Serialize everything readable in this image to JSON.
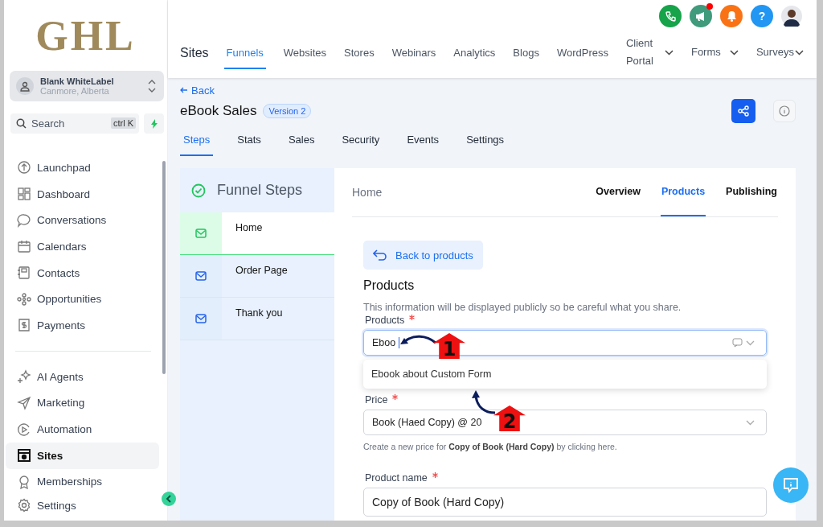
{
  "logo": "GHL",
  "account": {
    "name": "Blank WhiteLabel",
    "location": "Canmore, Alberta"
  },
  "search": {
    "placeholder": "Search",
    "shortcut": "ctrl K"
  },
  "nav_groups": [
    [
      {
        "label": "Launchpad",
        "selected": false
      },
      {
        "label": "Dashboard",
        "selected": false
      },
      {
        "label": "Conversations",
        "selected": false
      },
      {
        "label": "Calendars",
        "selected": false
      },
      {
        "label": "Contacts",
        "selected": false
      },
      {
        "label": "Opportunities",
        "selected": false
      },
      {
        "label": "Payments",
        "selected": false
      }
    ],
    [
      {
        "label": "AI Agents",
        "selected": false
      },
      {
        "label": "Marketing",
        "selected": false
      },
      {
        "label": "Automation",
        "selected": false
      },
      {
        "label": "Sites",
        "selected": true
      },
      {
        "label": "Memberships",
        "selected": false
      },
      {
        "label": "Settings",
        "selected": false
      }
    ]
  ],
  "header": {
    "title": "Sites",
    "tabs": [
      {
        "label": "Funnels",
        "selected": true,
        "dropdown": false
      },
      {
        "label": "Websites",
        "selected": false,
        "dropdown": false
      },
      {
        "label": "Stores",
        "selected": false,
        "dropdown": false
      },
      {
        "label": "Webinars",
        "selected": false,
        "dropdown": false
      },
      {
        "label": "Analytics",
        "selected": false,
        "dropdown": false
      },
      {
        "label": "Blogs",
        "selected": false,
        "dropdown": false
      },
      {
        "label": "WordPress",
        "selected": false,
        "dropdown": false
      },
      {
        "label": "Client Portal",
        "selected": false,
        "dropdown": true
      },
      {
        "label": "Forms",
        "selected": false,
        "dropdown": true
      },
      {
        "label": "Surveys",
        "selected": false,
        "dropdown": true
      }
    ],
    "help_label": "?",
    "announcement_unread": true
  },
  "page": {
    "back": "Back",
    "title": "eBook Sales",
    "version": "Version 2",
    "tabs": [
      {
        "label": "Steps",
        "selected": true
      },
      {
        "label": "Stats",
        "selected": false
      },
      {
        "label": "Sales",
        "selected": false
      },
      {
        "label": "Security",
        "selected": false
      },
      {
        "label": "Events",
        "selected": false
      },
      {
        "label": "Settings",
        "selected": false
      }
    ]
  },
  "funnel_steps": {
    "title": "Funnel Steps",
    "steps": [
      {
        "name": "Home",
        "selected": true
      },
      {
        "name": "Order Page",
        "selected": false
      },
      {
        "name": "Thank you",
        "selected": false
      }
    ]
  },
  "step_panel": {
    "breadcrumb": "Home",
    "tabs": [
      {
        "label": "Overview",
        "selected": false
      },
      {
        "label": "Products",
        "selected": true
      },
      {
        "label": "Publishing",
        "selected": false
      }
    ],
    "back_button": "Back to products",
    "section_title": "Products",
    "description": "This information will be displayed publicly so be careful what you share.",
    "product_field": {
      "label": "Products",
      "required": true,
      "value": "Eboo",
      "options": [
        "Ebook about Custom Form"
      ]
    },
    "price_field": {
      "label": "Price",
      "required": true,
      "value": "Book (Haed Copy) @ 20",
      "hint": "Create a new price for **Copy of Book (Hard Copy)** by clicking here."
    },
    "name_field": {
      "label": "Product name",
      "required": true,
      "value": "Copy of Book (Hard Copy)"
    }
  },
  "callouts": [
    {
      "number": "1"
    },
    {
      "number": "2"
    }
  ]
}
